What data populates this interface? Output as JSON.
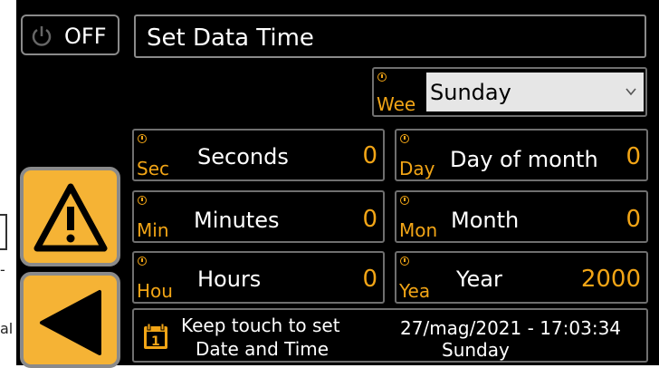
{
  "left_edge": {
    "fragment_1": "-",
    "fragment_2": "al"
  },
  "power_button": {
    "label": "OFF",
    "icon": "power-icon"
  },
  "title": "Set Data Time",
  "weekday": {
    "abbr": "Wee",
    "value": "Sunday"
  },
  "fields": {
    "seconds": {
      "abbr": "Sec",
      "label": "Seconds",
      "value": "0"
    },
    "minutes": {
      "abbr": "Min",
      "label": "Minutes",
      "value": "0"
    },
    "hours": {
      "abbr": "Hou",
      "label": "Hours",
      "value": "0"
    },
    "day": {
      "abbr": "Day",
      "label": "Day of month",
      "value": "0"
    },
    "month": {
      "abbr": "Mon",
      "label": "Month",
      "value": "0"
    },
    "year": {
      "abbr": "Yea",
      "label": "Year",
      "value": "2000"
    }
  },
  "footer": {
    "hint_line1": "Keep touch to set",
    "hint_line2": "Date and Time",
    "datetime": "27/mag/2021 - 17:03:34",
    "day_name": "Sunday",
    "calendar_digit": "1"
  },
  "colors": {
    "accent": "#f2a516",
    "button": "#f5b335",
    "background": "#000000",
    "border": "#6f6f6f"
  }
}
